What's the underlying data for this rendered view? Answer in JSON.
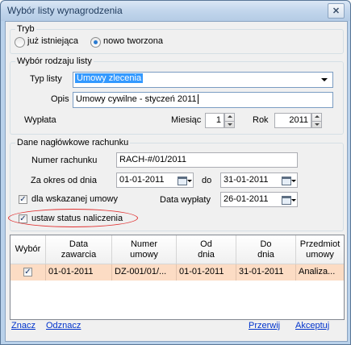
{
  "window": {
    "title": "Wybór listy wynagrodzenia"
  },
  "colors": {
    "accent": "#3399ff",
    "row_highlight": "#fcdcc4",
    "marker": "#e03030",
    "link": "#0033cc"
  },
  "tryb": {
    "title": "Tryb",
    "option_existing": "już istniejąca",
    "option_new": "nowo tworzona",
    "selected": "nowo tworzona"
  },
  "rodzaj": {
    "title": "Wybór rodzaju listy",
    "typ_label": "Typ listy",
    "typ_value": "Umowy zlecenia",
    "opis_label": "Opis",
    "opis_value": "Umowy cywilne - styczeń 2011",
    "wyplata_label": "Wypłata",
    "miesiac_label": "Miesiąc",
    "miesiac_value": "1",
    "rok_label": "Rok",
    "rok_value": "2011"
  },
  "dane": {
    "title": "Dane nagłówkowe rachunku",
    "numer_label": "Numer rachunku",
    "numer_value": "RACH-#/01/2011",
    "okres_label": "Za okres od dnia",
    "okres_od": "01-01-2011",
    "do_label": "do",
    "okres_do": "31-01-2011",
    "dla_umowy_label": "dla wskazanej umowy",
    "dla_umowy_checked": true,
    "data_wyplaty_label": "Data wypłaty",
    "data_wyplaty_value": "26-01-2011",
    "status_label": "ustaw status naliczenia",
    "status_checked": true
  },
  "grid": {
    "columns": [
      "Wybór",
      "Data zawarcia",
      "Numer umowy",
      "Od dnia",
      "Do dnia",
      "Przedmiot umowy"
    ],
    "rows": [
      {
        "wybor": true,
        "data_zawarcia": "01-01-2011",
        "numer": "DZ-001/01/...",
        "od": "01-01-2011",
        "do": "31-01-2011",
        "przedmiot": "Analiza..."
      }
    ]
  },
  "footer": {
    "znacz": "Znacz",
    "odznacz": "Odznacz",
    "przerwij": "Przerwij",
    "akceptuj": "Akceptuj"
  },
  "icons": [
    "close-icon",
    "dropdown-arrow-icon",
    "spin-up-icon",
    "spin-down-icon",
    "calendar-icon",
    "checkbox-check-icon"
  ]
}
